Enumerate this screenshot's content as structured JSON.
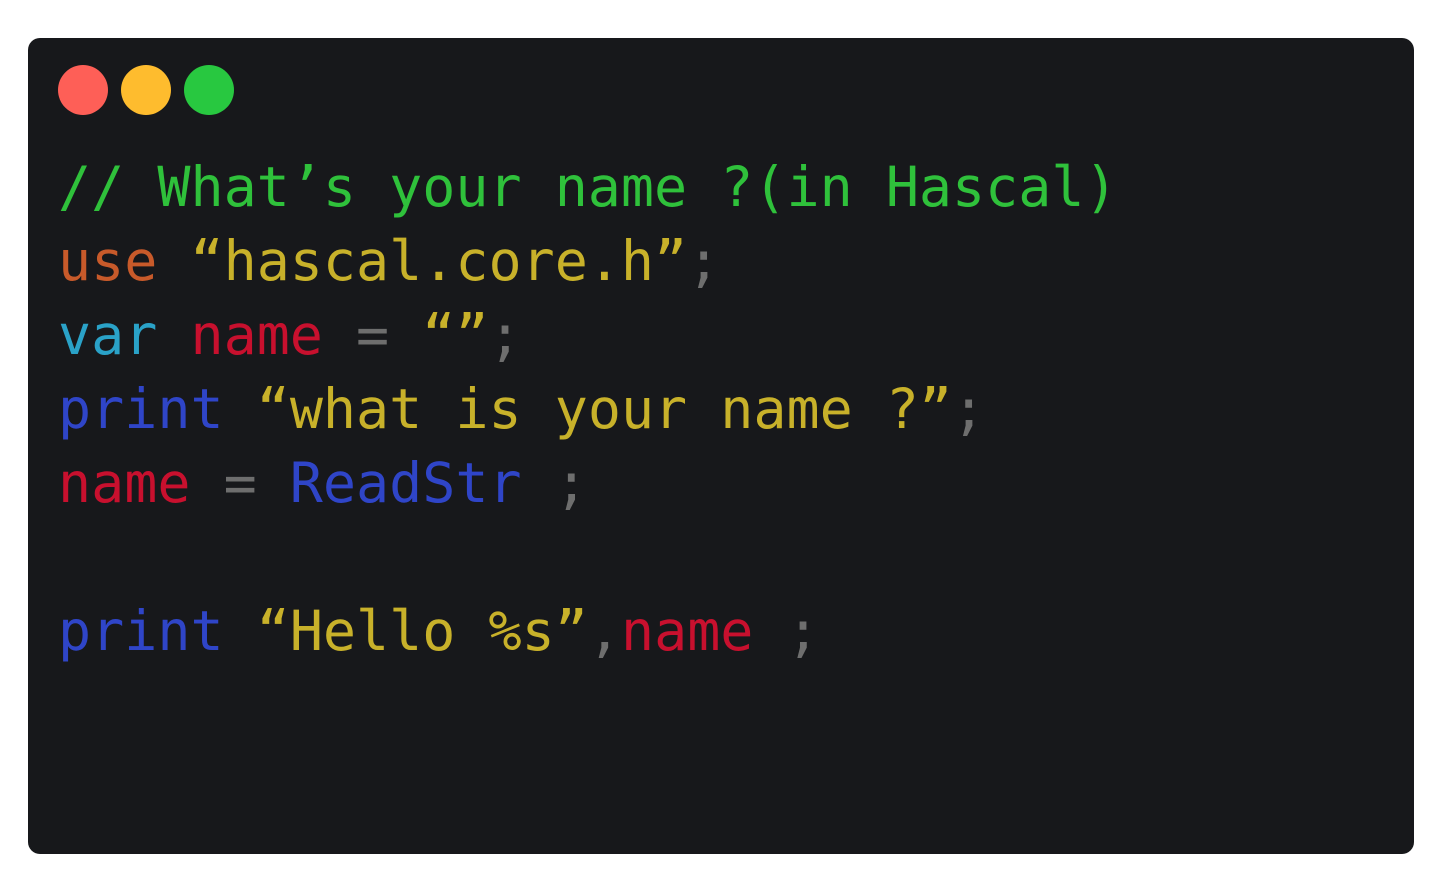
{
  "colors": {
    "background": "#17181b",
    "close": "#fe5f57",
    "minimize": "#febc2e",
    "maximize": "#28c840",
    "comment": "#2fc13b",
    "keyword_use": "#c85a2a",
    "keyword_var": "#2aa2c8",
    "keyword_print": "#2f45c8",
    "identifier": "#c8102e",
    "string": "#c8b12a",
    "punctuation": "#6e6e6e"
  },
  "window_controls": [
    {
      "name": "close-button-icon",
      "color": "#fe5f57"
    },
    {
      "name": "minimize-button-icon",
      "color": "#febc2e"
    },
    {
      "name": "maximize-button-icon",
      "color": "#28c840"
    }
  ],
  "code_lines": [
    [
      {
        "text": "// What’s your name ?(in Hascal)",
        "kind": "comment"
      }
    ],
    [
      {
        "text": "use",
        "kind": "keyword_use"
      },
      {
        "text": " ",
        "kind": "punctuation"
      },
      {
        "text": "“hascal.core.h”",
        "kind": "string"
      },
      {
        "text": ";",
        "kind": "punctuation"
      }
    ],
    [
      {
        "text": "var",
        "kind": "keyword_var"
      },
      {
        "text": " ",
        "kind": "punctuation"
      },
      {
        "text": "name",
        "kind": "identifier"
      },
      {
        "text": " = ",
        "kind": "punctuation"
      },
      {
        "text": "“”",
        "kind": "string"
      },
      {
        "text": ";",
        "kind": "punctuation"
      }
    ],
    [
      {
        "text": "print",
        "kind": "keyword_print"
      },
      {
        "text": " ",
        "kind": "punctuation"
      },
      {
        "text": "“what is your name ?”",
        "kind": "string"
      },
      {
        "text": ";",
        "kind": "punctuation"
      }
    ],
    [
      {
        "text": "name",
        "kind": "identifier"
      },
      {
        "text": " = ",
        "kind": "punctuation"
      },
      {
        "text": "ReadStr",
        "kind": "keyword_print"
      },
      {
        "text": " ;",
        "kind": "punctuation"
      }
    ],
    [],
    [
      {
        "text": "print",
        "kind": "keyword_print"
      },
      {
        "text": " ",
        "kind": "punctuation"
      },
      {
        "text": "“Hello %s”",
        "kind": "string"
      },
      {
        "text": ",",
        "kind": "punctuation"
      },
      {
        "text": "name",
        "kind": "identifier"
      },
      {
        "text": " ;",
        "kind": "punctuation"
      }
    ]
  ]
}
